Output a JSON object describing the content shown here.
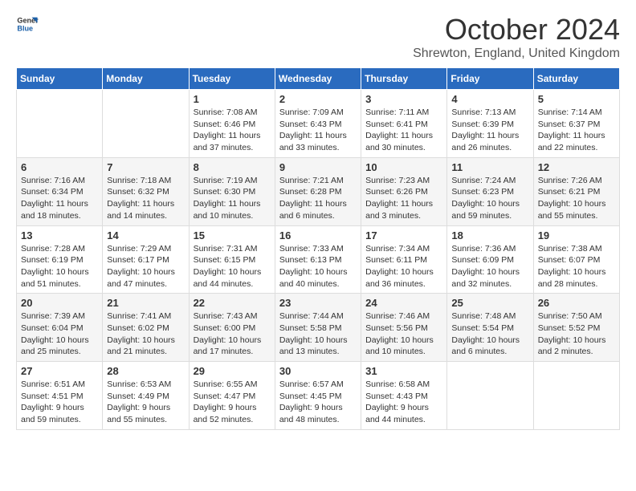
{
  "header": {
    "logo": {
      "general": "General",
      "blue": "Blue"
    },
    "title": "October 2024",
    "location": "Shrewton, England, United Kingdom"
  },
  "weekdays": [
    "Sunday",
    "Monday",
    "Tuesday",
    "Wednesday",
    "Thursday",
    "Friday",
    "Saturday"
  ],
  "weeks": [
    [
      {
        "day": "",
        "info": ""
      },
      {
        "day": "",
        "info": ""
      },
      {
        "day": "1",
        "info": "Sunrise: 7:08 AM\nSunset: 6:46 PM\nDaylight: 11 hours and 37 minutes."
      },
      {
        "day": "2",
        "info": "Sunrise: 7:09 AM\nSunset: 6:43 PM\nDaylight: 11 hours and 33 minutes."
      },
      {
        "day": "3",
        "info": "Sunrise: 7:11 AM\nSunset: 6:41 PM\nDaylight: 11 hours and 30 minutes."
      },
      {
        "day": "4",
        "info": "Sunrise: 7:13 AM\nSunset: 6:39 PM\nDaylight: 11 hours and 26 minutes."
      },
      {
        "day": "5",
        "info": "Sunrise: 7:14 AM\nSunset: 6:37 PM\nDaylight: 11 hours and 22 minutes."
      }
    ],
    [
      {
        "day": "6",
        "info": "Sunrise: 7:16 AM\nSunset: 6:34 PM\nDaylight: 11 hours and 18 minutes."
      },
      {
        "day": "7",
        "info": "Sunrise: 7:18 AM\nSunset: 6:32 PM\nDaylight: 11 hours and 14 minutes."
      },
      {
        "day": "8",
        "info": "Sunrise: 7:19 AM\nSunset: 6:30 PM\nDaylight: 11 hours and 10 minutes."
      },
      {
        "day": "9",
        "info": "Sunrise: 7:21 AM\nSunset: 6:28 PM\nDaylight: 11 hours and 6 minutes."
      },
      {
        "day": "10",
        "info": "Sunrise: 7:23 AM\nSunset: 6:26 PM\nDaylight: 11 hours and 3 minutes."
      },
      {
        "day": "11",
        "info": "Sunrise: 7:24 AM\nSunset: 6:23 PM\nDaylight: 10 hours and 59 minutes."
      },
      {
        "day": "12",
        "info": "Sunrise: 7:26 AM\nSunset: 6:21 PM\nDaylight: 10 hours and 55 minutes."
      }
    ],
    [
      {
        "day": "13",
        "info": "Sunrise: 7:28 AM\nSunset: 6:19 PM\nDaylight: 10 hours and 51 minutes."
      },
      {
        "day": "14",
        "info": "Sunrise: 7:29 AM\nSunset: 6:17 PM\nDaylight: 10 hours and 47 minutes."
      },
      {
        "day": "15",
        "info": "Sunrise: 7:31 AM\nSunset: 6:15 PM\nDaylight: 10 hours and 44 minutes."
      },
      {
        "day": "16",
        "info": "Sunrise: 7:33 AM\nSunset: 6:13 PM\nDaylight: 10 hours and 40 minutes."
      },
      {
        "day": "17",
        "info": "Sunrise: 7:34 AM\nSunset: 6:11 PM\nDaylight: 10 hours and 36 minutes."
      },
      {
        "day": "18",
        "info": "Sunrise: 7:36 AM\nSunset: 6:09 PM\nDaylight: 10 hours and 32 minutes."
      },
      {
        "day": "19",
        "info": "Sunrise: 7:38 AM\nSunset: 6:07 PM\nDaylight: 10 hours and 28 minutes."
      }
    ],
    [
      {
        "day": "20",
        "info": "Sunrise: 7:39 AM\nSunset: 6:04 PM\nDaylight: 10 hours and 25 minutes."
      },
      {
        "day": "21",
        "info": "Sunrise: 7:41 AM\nSunset: 6:02 PM\nDaylight: 10 hours and 21 minutes."
      },
      {
        "day": "22",
        "info": "Sunrise: 7:43 AM\nSunset: 6:00 PM\nDaylight: 10 hours and 17 minutes."
      },
      {
        "day": "23",
        "info": "Sunrise: 7:44 AM\nSunset: 5:58 PM\nDaylight: 10 hours and 13 minutes."
      },
      {
        "day": "24",
        "info": "Sunrise: 7:46 AM\nSunset: 5:56 PM\nDaylight: 10 hours and 10 minutes."
      },
      {
        "day": "25",
        "info": "Sunrise: 7:48 AM\nSunset: 5:54 PM\nDaylight: 10 hours and 6 minutes."
      },
      {
        "day": "26",
        "info": "Sunrise: 7:50 AM\nSunset: 5:52 PM\nDaylight: 10 hours and 2 minutes."
      }
    ],
    [
      {
        "day": "27",
        "info": "Sunrise: 6:51 AM\nSunset: 4:51 PM\nDaylight: 9 hours and 59 minutes."
      },
      {
        "day": "28",
        "info": "Sunrise: 6:53 AM\nSunset: 4:49 PM\nDaylight: 9 hours and 55 minutes."
      },
      {
        "day": "29",
        "info": "Sunrise: 6:55 AM\nSunset: 4:47 PM\nDaylight: 9 hours and 52 minutes."
      },
      {
        "day": "30",
        "info": "Sunrise: 6:57 AM\nSunset: 4:45 PM\nDaylight: 9 hours and 48 minutes."
      },
      {
        "day": "31",
        "info": "Sunrise: 6:58 AM\nSunset: 4:43 PM\nDaylight: 9 hours and 44 minutes."
      },
      {
        "day": "",
        "info": ""
      },
      {
        "day": "",
        "info": ""
      }
    ]
  ]
}
